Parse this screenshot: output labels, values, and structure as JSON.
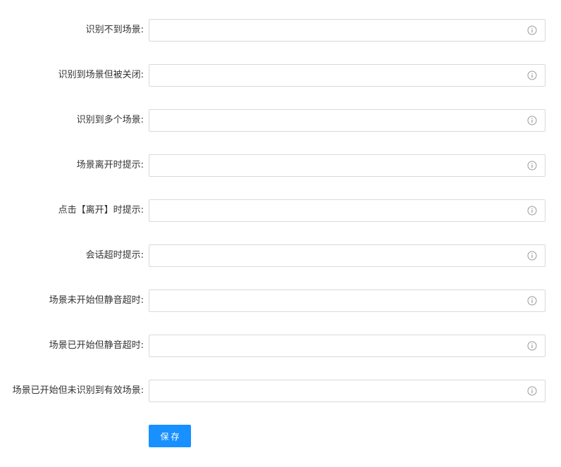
{
  "form": {
    "fields": [
      {
        "label": "识别不到场景:",
        "value": "",
        "info_icon": "info-circle-icon"
      },
      {
        "label": "识别到场景但被关闭:",
        "value": "",
        "info_icon": "info-circle-icon"
      },
      {
        "label": "识别到多个场景:",
        "value": "",
        "info_icon": "info-circle-icon"
      },
      {
        "label": "场景离开时提示:",
        "value": "",
        "info_icon": "info-circle-icon"
      },
      {
        "label": "点击【离开】时提示:",
        "value": "",
        "info_icon": "info-circle-icon"
      },
      {
        "label": "会话超时提示:",
        "value": "",
        "info_icon": "info-circle-icon"
      },
      {
        "label": "场景未开始但静音超时:",
        "value": "",
        "info_icon": "info-circle-icon"
      },
      {
        "label": "场景已开始但静音超时:",
        "value": "",
        "info_icon": "info-circle-icon"
      },
      {
        "label": "场景已开始但未识别到有效场景:",
        "value": "",
        "info_icon": "info-circle-icon"
      }
    ],
    "save_label": "保存"
  },
  "colors": {
    "primary": "#1890ff",
    "border": "#d9d9d9",
    "icon": "#999999",
    "label": "#333333"
  }
}
